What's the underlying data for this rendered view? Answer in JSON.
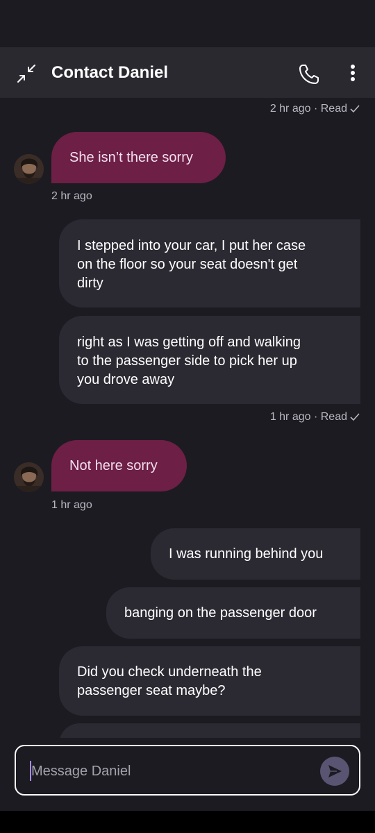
{
  "header": {
    "title": "Contact Daniel",
    "collapse_icon": "collapse-arrows-icon",
    "call_icon": "phone-icon",
    "menu_icon": "more-vertical-icon"
  },
  "messages": [
    {
      "direction": "out-meta",
      "text": "2 hr ago · Read"
    },
    {
      "direction": "in",
      "text": "She isn’t there sorry",
      "time": "2 hr ago"
    },
    {
      "direction": "out",
      "lines": [
        "I stepped into your car, I put her case",
        "on the floor so your seat doesn't get",
        "dirty"
      ]
    },
    {
      "direction": "out",
      "lines": [
        "right as I was getting off and walking",
        "to the passenger side to pick her up",
        "you drove away"
      ]
    },
    {
      "direction": "out-meta",
      "text": "1 hr ago · Read"
    },
    {
      "direction": "in",
      "text": "Not here sorry",
      "time": "1 hr ago"
    },
    {
      "direction": "out",
      "lines": [
        "I was running behind you"
      ]
    },
    {
      "direction": "out",
      "lines": [
        "banging on the passenger door"
      ]
    },
    {
      "direction": "out",
      "lines": [
        "Did you check underneath the",
        "passenger seat maybe?"
      ]
    }
  ],
  "composer": {
    "placeholder": "Message Daniel",
    "send_icon": "send-icon"
  },
  "colors": {
    "background": "#1c1b22",
    "header": "#2a2930",
    "outgoing_bubble": "#2b2a33",
    "incoming_bubble": "#6e1f45",
    "send_button": "#5a5473"
  }
}
